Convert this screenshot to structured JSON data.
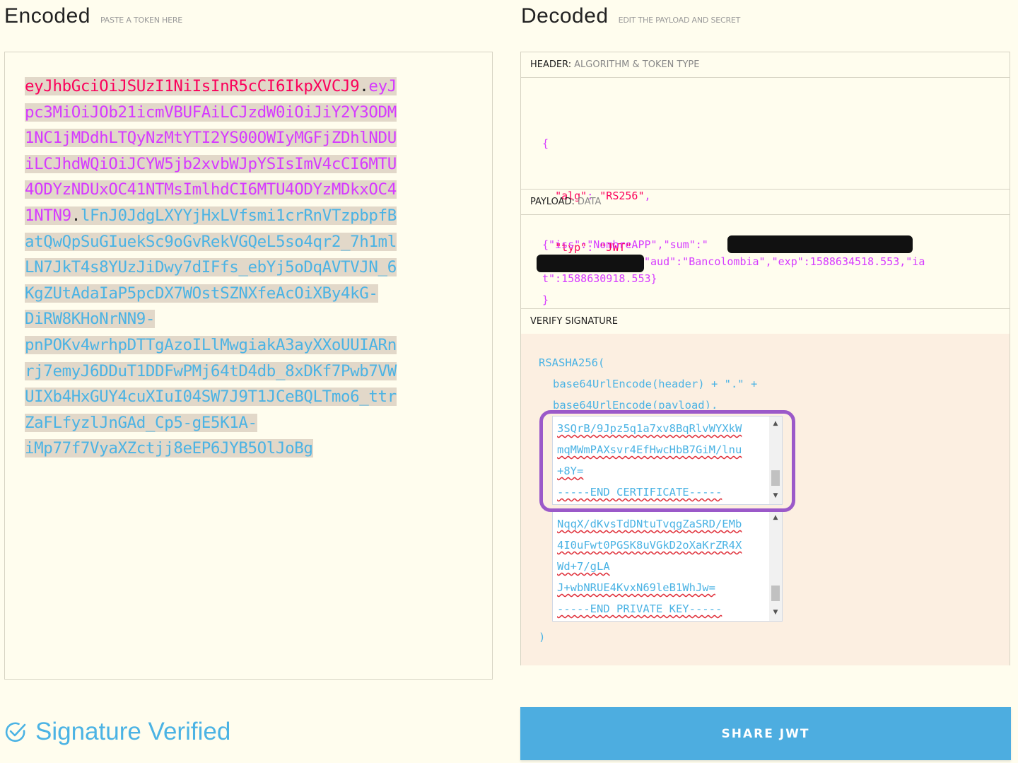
{
  "encoded": {
    "title": "Encoded",
    "subtitle": "PASTE A TOKEN HERE",
    "token_lines": [
      [
        {
          "t": "header",
          "v": "eyJhbGciOiJSUzI1NiIsInR5cCI6IkpXVCJ9"
        },
        {
          "t": "dot",
          "v": "."
        },
        {
          "t": "payload",
          "v": "eyJ"
        }
      ],
      [
        {
          "t": "payload",
          "v": "pc3MiOiJOb21icmVBUFAiLCJzdW0iOiJiY2Y3ODM"
        }
      ],
      [
        {
          "t": "payload",
          "v": "1NC1jMDdhLTQyNzMtYTI2YS00OWIyMGFjZDhlNDU"
        }
      ],
      [
        {
          "t": "payload",
          "v": "iLCJhdWQiOiJCYW5jb2xvbWJpYSIsImV4cCI6MTU"
        }
      ],
      [
        {
          "t": "payload",
          "v": "4ODYzNDUxOC41NTMsImlhdCI6MTU4ODYzMDkxOC4"
        }
      ],
      [
        {
          "t": "payload",
          "v": "1NTN9"
        },
        {
          "t": "dot",
          "v": "."
        },
        {
          "t": "sig",
          "v": "lFnJ0JdgLXYYjHxLVfsmi1crRnVTzpbpfB"
        }
      ],
      [
        {
          "t": "sig",
          "v": "atQwQpSuGIuekSc9oGvRekVGQeL5so4qr2_7h1ml"
        }
      ],
      [
        {
          "t": "sig",
          "v": "LN7JkT4s8YUzJiDwy7dIFfs_ebYj5oDqAVTVJN_6"
        }
      ],
      [
        {
          "t": "sig",
          "v": "KgZUtAdaIaP5pcDX7WOstSZNXfeAcOiXBy4kG-"
        }
      ],
      [
        {
          "t": "sig",
          "v": "DiRW8KHoNrNN9-"
        }
      ],
      [
        {
          "t": "sig",
          "v": "pnPOKv4wrhpDTTgAzoILlMwgiakA3ayXXoUUIARn"
        }
      ],
      [
        {
          "t": "sig",
          "v": "rj7emyJ6DDuT1DDFwPMj64tD4db_8xDKf7Pwb7VW"
        }
      ],
      [
        {
          "t": "sig",
          "v": "UIXb4HxGUY4cuXIuI04SW7J9T1JCeBQLTmo6_ttr"
        }
      ],
      [
        {
          "t": "sig",
          "v": "ZaFLfyzlJnGAd_Cp5-gE5K1A-"
        }
      ],
      [
        {
          "t": "sig",
          "v": "iMp77f7VyaXZctjj8eEP6JYB5OlJoBg"
        }
      ]
    ]
  },
  "decoded": {
    "title": "Decoded",
    "subtitle": "EDIT THE PAYLOAD AND SECRET",
    "header_label": "HEADER:",
    "header_sub": "ALGORITHM & TOKEN TYPE",
    "header_json": {
      "open": "{",
      "alg_key": "\"alg\"",
      "alg_val": "\"RS256\"",
      "typ_key": "\"typ\"",
      "typ_val": "\"JWT\"",
      "close": "}"
    },
    "payload_label": "PAYLOAD:",
    "payload_sub": "DATA",
    "payload_line1": "{\"iss\":\"NombreAPP\",\"sum\":\"",
    "payload_line2": "\"aud\":\"Bancolombia\",\"exp\":1588634518.553,\"ia",
    "payload_line3": "t\":1588630918.553}",
    "verify_label": "VERIFY SIGNATURE",
    "verify_fn": "RSASHA256(",
    "verify_line2": "base64UrlEncode(header) + \".\" +",
    "verify_line3": "base64UrlEncode(payload),",
    "verify_close": ")",
    "public_key_lines": [
      "3SQrB/9Jpz5q1a7xv8BqRlvWYXkW",
      "mqMWmPAXsvr4EfHwcHbB7GiM/lnu",
      "+8Y=",
      "-----END CERTIFICATE-----"
    ],
    "private_key_lines": [
      "NqqX/dKvsTdDNtuTvqgZaSRD/EMb",
      "4I0uFwt0PGSK8uVGkD2oXaKrZR4X",
      "Wd+7/gLA",
      "J+wbNRUE4KvxN69leB1WhJw=",
      "-----END PRIVATE KEY-----"
    ]
  },
  "status": {
    "signature_text": "Signature Verified"
  },
  "actions": {
    "share_label": "SHARE JWT"
  },
  "colors": {
    "header": "#fb015b",
    "payload": "#d63aff",
    "signature": "#4bb3e4",
    "accent": "#4dade0",
    "highlight": "#9b59c9"
  }
}
